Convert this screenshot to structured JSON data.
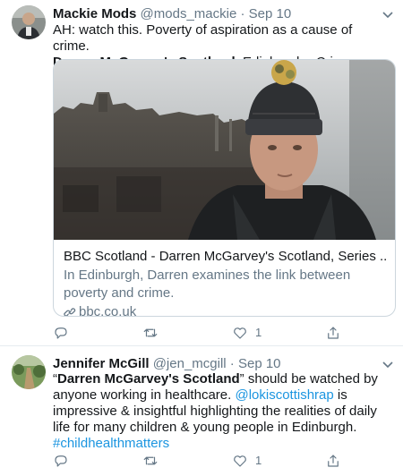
{
  "tweets": [
    {
      "author_name": "Mackie Mods",
      "handle": "@mods_mackie",
      "sep": "·",
      "date": "Sep 10",
      "line1": "AH: watch this. Poverty of aspiration as a cause of crime.",
      "line2_bold": "Darren McGarvey's Scotland",
      "line2_rest": ", Edinburgh - Crime:",
      "card": {
        "title": "BBC Scotland - Darren McGarvey's Scotland, Series ...",
        "description": "In Edinburgh, Darren examines the link between poverty and crime.",
        "domain": "bbc.co.uk"
      },
      "likes": "1"
    },
    {
      "author_name": "Jennifer McGill",
      "handle": "@jen_mcgill",
      "sep": "·",
      "date": "Sep 10",
      "open_quote": "“",
      "bold_title": "Darren McGarvey's Scotland",
      "after_title": "” should be watched by anyone working in healthcare. ",
      "mention": "@lokiscottishrap",
      "after_mention": " is impressive & insightful highlighting the realities of daily life for many children & young people in Edinburgh.",
      "hashtag": "#childhealthmatters",
      "likes": "1"
    }
  ],
  "colors": {
    "text": "#14171a",
    "secondary": "#657786",
    "link": "#1b95e0",
    "border": "#ccd6dd"
  },
  "icons": [
    "reply-icon",
    "retweet-icon",
    "like-icon",
    "share-icon",
    "chevron-down-icon",
    "link-icon"
  ]
}
